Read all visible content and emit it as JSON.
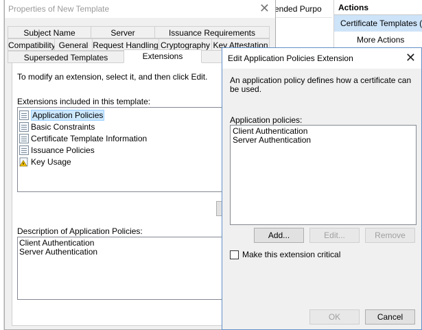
{
  "background": {
    "column_fragment": "ended Purpo",
    "actions": {
      "header": "Actions",
      "selected": "Certificate Templates (A",
      "more": "More Actions"
    }
  },
  "properties_dialog": {
    "title": "Properties of New Template",
    "tabs_row1": [
      "Subject Name",
      "Server",
      "Issuance Requirements"
    ],
    "tabs_row2": [
      "Compatibility",
      "General",
      "Request Handling",
      "Cryptography",
      "Key Attestation"
    ],
    "tabs_row3": [
      "Superseded Templates",
      "Extensions"
    ],
    "active_tab": "Extensions",
    "instruction": "To modify an extension, select it, and then click Edit.",
    "extensions_label": "Extensions included in this template:",
    "extensions": [
      {
        "name": "Application Policies",
        "icon": "extension-icon",
        "selected": true
      },
      {
        "name": "Basic Constraints",
        "icon": "extension-icon",
        "selected": false
      },
      {
        "name": "Certificate Template Information",
        "icon": "extension-icon",
        "selected": false
      },
      {
        "name": "Issuance Policies",
        "icon": "extension-icon",
        "selected": false
      },
      {
        "name": "Key Usage",
        "icon": "warning-extension-icon",
        "selected": false
      }
    ],
    "description_label": "Description of Application Policies:",
    "description_lines": [
      "Client Authentication",
      "Server Authentication"
    ]
  },
  "edit_dialog": {
    "title": "Edit Application Policies Extension",
    "description": "An application policy defines how a certificate can be used.",
    "policies_label": "Application policies:",
    "policies": [
      "Client Authentication",
      "Server Authentication"
    ],
    "add_label": "Add...",
    "edit_label": "Edit...",
    "remove_label": "Remove",
    "critical_label": "Make this extension critical",
    "critical_checked": false,
    "ok_label": "OK",
    "cancel_label": "Cancel"
  }
}
